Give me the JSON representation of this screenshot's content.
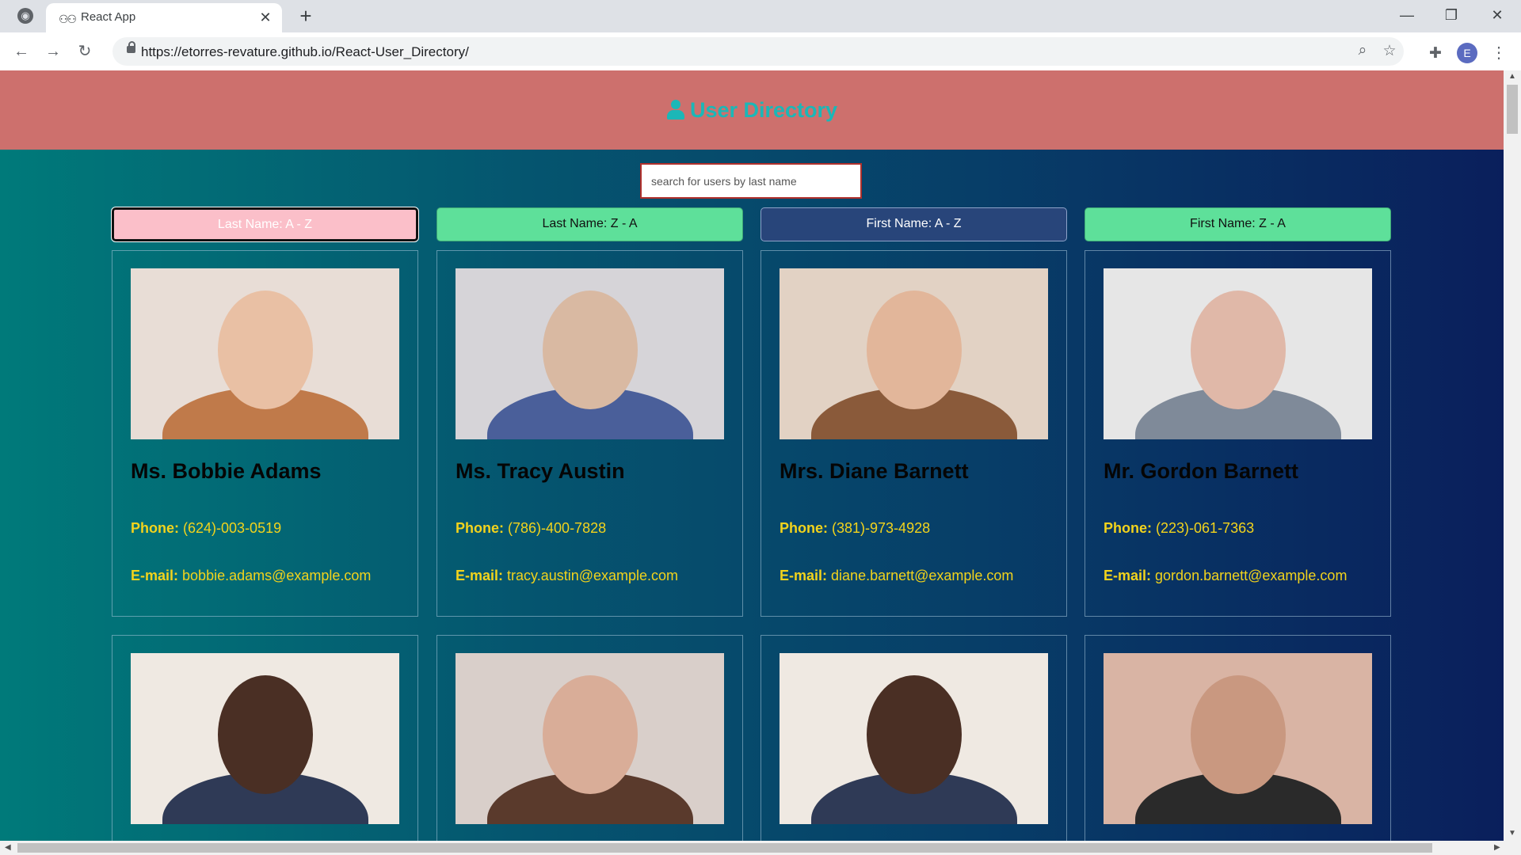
{
  "browser": {
    "tab_title": "React App",
    "url": "https://etorres-revature.github.io/React-User_Directory/",
    "profile_initial": "E",
    "icons": {
      "site": "globe-icon",
      "favicon": "react-app-favicon-icon",
      "close": "close-icon",
      "new_tab": "plus-icon",
      "back": "back-arrow-icon",
      "forward": "forward-arrow-icon",
      "reload": "reload-icon",
      "lock": "lock-icon",
      "zoom": "zoom-icon",
      "bookmark": "star-icon",
      "extensions": "puzzle-icon",
      "menu": "more-vert-icon"
    },
    "glyphs": {
      "globe": "◉",
      "favicon": "⚇⚇",
      "close": "✕",
      "new_tab": "+",
      "minimize": "—",
      "restore": "❐",
      "win_close": "✕",
      "back": "←",
      "forward": "→",
      "reload": "↻",
      "zoom": "⌕",
      "star": "☆",
      "puzzle": "✚",
      "dots": "⋮"
    }
  },
  "page": {
    "title": "User Directory",
    "title_icon": "user-icon",
    "header_color": "#cd706d",
    "title_color": "#1bb7b7",
    "search": {
      "placeholder": "search for users by last name",
      "value": ""
    },
    "sort_buttons": [
      {
        "label": "Last Name: A - Z",
        "active": true
      },
      {
        "label": "Last Name: Z - A",
        "active": false
      },
      {
        "label": "First Name: A - Z",
        "active": false
      },
      {
        "label": "First Name: Z - A",
        "active": false
      }
    ],
    "phone_label": "Phone:",
    "email_label": "E-mail:",
    "users": [
      {
        "name": "Ms. Bobbie Adams",
        "phone": "(624)-003-0519",
        "email": "bobbie.adams@example.com",
        "photo": "portrait-photo"
      },
      {
        "name": "Ms. Tracy Austin",
        "phone": "(786)-400-7828",
        "email": "tracy.austin@example.com",
        "photo": "portrait-photo"
      },
      {
        "name": "Mrs. Diane Barnett",
        "phone": "(381)-973-4928",
        "email": "diane.barnett@example.com",
        "photo": "portrait-photo"
      },
      {
        "name": "Mr. Gordon Barnett",
        "phone": "(223)-061-7363",
        "email": "gordon.barnett@example.com",
        "photo": "portrait-photo"
      },
      {
        "name": "",
        "phone": "",
        "email": "",
        "photo": "portrait-photo"
      },
      {
        "name": "",
        "phone": "",
        "email": "",
        "photo": "portrait-photo"
      },
      {
        "name": "",
        "phone": "",
        "email": "",
        "photo": "portrait-photo"
      },
      {
        "name": "",
        "phone": "",
        "email": "",
        "photo": "portrait-photo"
      }
    ],
    "text_color": "#f2d31c"
  }
}
